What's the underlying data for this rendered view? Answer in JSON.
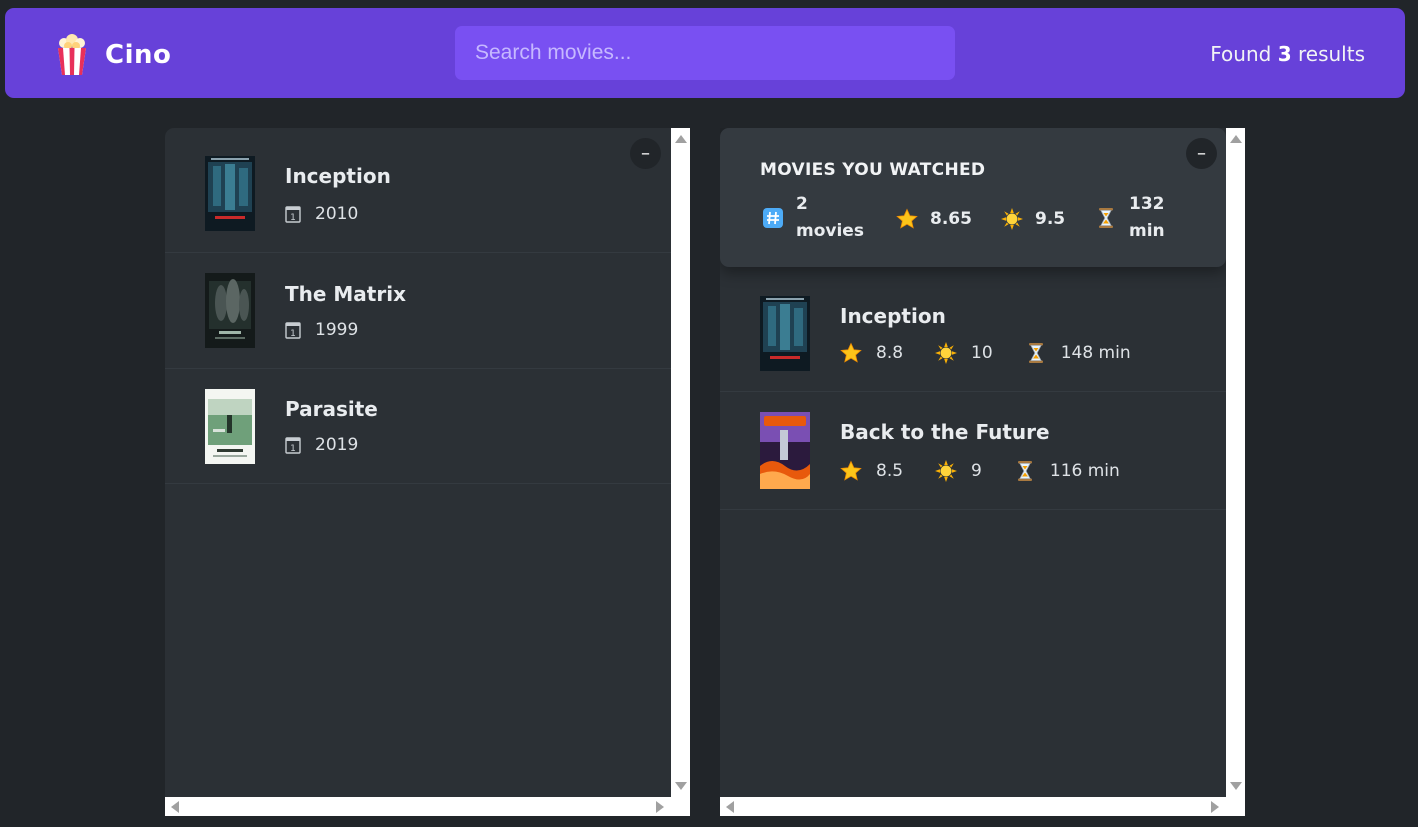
{
  "app": {
    "name": "Cino"
  },
  "search": {
    "placeholder": "Search movies..."
  },
  "results": {
    "prefix": "Found",
    "count": "3",
    "suffix": "results"
  },
  "list": {
    "toggle": "–",
    "movies": [
      {
        "title": "Inception",
        "year": "2010"
      },
      {
        "title": "The Matrix",
        "year": "1999"
      },
      {
        "title": "Parasite",
        "year": "2019"
      }
    ]
  },
  "watched": {
    "toggle": "–",
    "summary": {
      "title": "MOVIES YOU WATCHED",
      "count_num": "2",
      "count_label": "movies",
      "avg_imdb": "8.65",
      "avg_user": "9.5",
      "runtime_num": "132",
      "runtime_unit": "min"
    },
    "movies": [
      {
        "title": "Inception",
        "imdb": "8.8",
        "user": "10",
        "runtime": "148 min"
      },
      {
        "title": "Back to the Future",
        "imdb": "8.5",
        "user": "9",
        "runtime": "116 min"
      }
    ]
  },
  "colors": {
    "background": "#212529",
    "navbar": "#6741d9",
    "search": "#7950f2",
    "panel": "#2b3035",
    "summary": "#343a40",
    "star": "#fcc419"
  },
  "icons": {
    "logo": "popcorn-icon",
    "year": "calendar-icon",
    "count": "hash-icon",
    "imdb": "star-icon",
    "user": "sun-icon",
    "runtime": "hourglass-icon"
  }
}
